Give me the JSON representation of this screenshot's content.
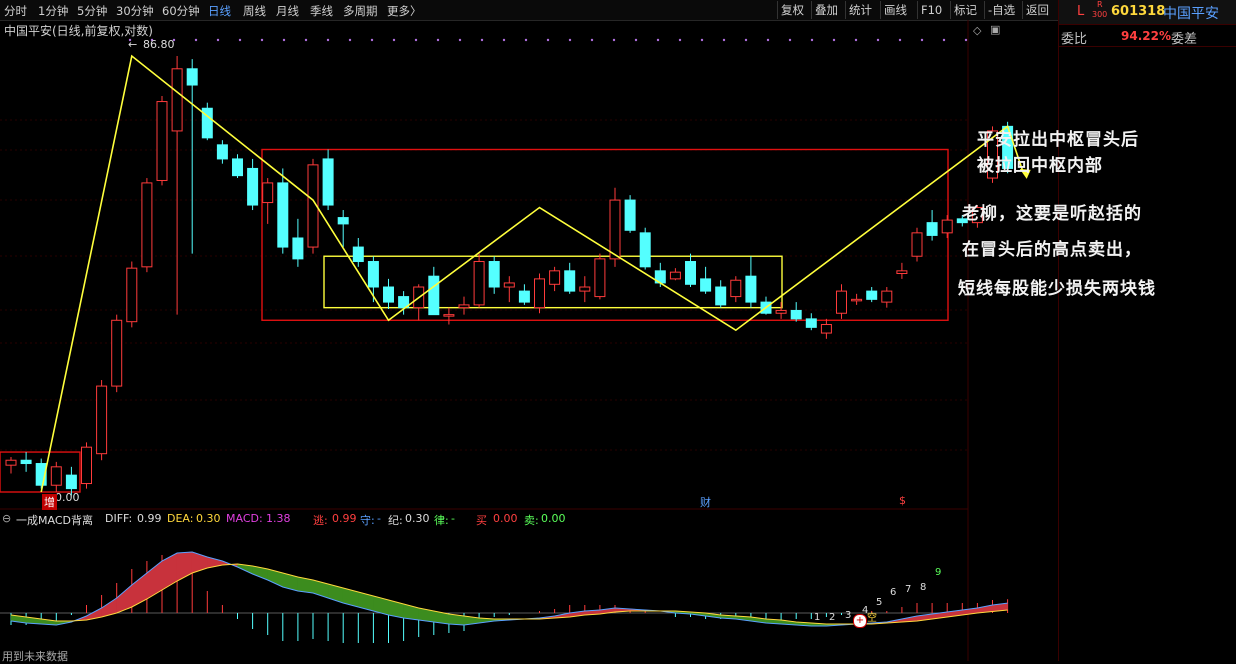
{
  "toolbar": {
    "timeframes": [
      "分时",
      "1分钟",
      "5分钟",
      "30分钟",
      "60分钟",
      "日线",
      "周线",
      "月线",
      "季线",
      "多周期",
      "更多〉"
    ],
    "active_timeframe": "日线",
    "buttons": [
      "复权",
      "叠加",
      "统计",
      "画线",
      "F10",
      "标记",
      "-自选",
      "返回"
    ]
  },
  "stock_header": {
    "letter": "L",
    "badge_top": "R",
    "badge_bottom": "300",
    "code": "601318",
    "name": "中国平安"
  },
  "ratio_row": {
    "label_left": "委比",
    "value": "94.22%",
    "label_right": "委差"
  },
  "chart_title": "中国平安(日线,前复权,对数)",
  "labels": {
    "peak_price": "86.80",
    "low_price": "0.00",
    "zeng_marker": "增",
    "cai_marker": "财",
    "s_marker": "$",
    "footer": "用到未来数据"
  },
  "annotations": {
    "line1": "平安拉出中枢冒头后",
    "line2": "被拉回中枢内部",
    "line3": "老柳，这要是听赵括的",
    "line4": "在冒头后的高点卖出，",
    "line5": "短线每股能少损失两块钱"
  },
  "indicator": {
    "name": "一成MACD背离",
    "diff_label": "DIFF:",
    "diff_value": "0.99",
    "dea_label": "DEA:",
    "dea_value": "0.30",
    "macd_label": "MACD:",
    "macd_value": "1.38",
    "tao_label": "逃:",
    "tao_value": "0.99",
    "shou_label": "守:",
    "shou_value": "-",
    "ji_label": "纪:",
    "ji_value": "0.30",
    "lv_label": "律:",
    "lv_value": "-",
    "mai_label": "买",
    "mai_value": "0.00",
    "mai2_label": "卖:",
    "mai2_value": "0.00",
    "count_labels": [
      "1",
      "2",
      "3",
      "4",
      "5",
      "6",
      "7",
      "8",
      "9"
    ],
    "kong_marker": "空"
  },
  "colors": {
    "up": "#ff3b3b",
    "down": "#54ffff",
    "zigzag": "#ffff3c",
    "box_red": "#e01010",
    "box_yellow": "#ffff3c",
    "macd_red": "#c8323c",
    "macd_green": "#3c8c1e",
    "accent_blue": "#5aa0ff",
    "accent_yellow": "#ffd83c"
  },
  "chart_data": [
    {
      "type": "candlestick",
      "title": "中国平安(日线,前复权,对数)",
      "price_max_label": 86.8,
      "candles": [
        {
          "o": 55.6,
          "h": 56.1,
          "l": 55.1,
          "c": 55.9
        },
        {
          "o": 55.9,
          "h": 56.4,
          "l": 55.2,
          "c": 55.7
        },
        {
          "o": 55.7,
          "h": 56.0,
          "l": 54.2,
          "c": 54.4
        },
        {
          "o": 54.4,
          "h": 55.8,
          "l": 54.0,
          "c": 55.5
        },
        {
          "o": 55.0,
          "h": 55.5,
          "l": 53.8,
          "c": 54.2
        },
        {
          "o": 54.5,
          "h": 57.0,
          "l": 54.2,
          "c": 56.7
        },
        {
          "o": 56.3,
          "h": 61.0,
          "l": 55.9,
          "c": 60.6
        },
        {
          "o": 60.6,
          "h": 65.5,
          "l": 60.2,
          "c": 65.1
        },
        {
          "o": 65.0,
          "h": 69.4,
          "l": 64.6,
          "c": 68.9
        },
        {
          "o": 69.0,
          "h": 76.0,
          "l": 68.6,
          "c": 75.6
        },
        {
          "o": 75.8,
          "h": 83.1,
          "l": 75.4,
          "c": 82.6
        },
        {
          "o": 80.0,
          "h": 86.8,
          "l": 65.5,
          "c": 85.6
        },
        {
          "o": 85.6,
          "h": 86.5,
          "l": 70.0,
          "c": 84.1
        },
        {
          "o": 82.0,
          "h": 82.5,
          "l": 79.2,
          "c": 79.4
        },
        {
          "o": 78.8,
          "h": 79.2,
          "l": 77.2,
          "c": 77.6
        },
        {
          "o": 77.6,
          "h": 78.0,
          "l": 76.0,
          "c": 76.2
        },
        {
          "o": 76.8,
          "h": 77.6,
          "l": 73.4,
          "c": 73.8
        },
        {
          "o": 74.0,
          "h": 76.0,
          "l": 72.3,
          "c": 75.6
        },
        {
          "o": 75.6,
          "h": 76.8,
          "l": 70.0,
          "c": 70.5
        },
        {
          "o": 71.2,
          "h": 72.7,
          "l": 69.0,
          "c": 69.6
        },
        {
          "o": 70.5,
          "h": 77.6,
          "l": 70.0,
          "c": 77.1
        },
        {
          "o": 77.6,
          "h": 78.4,
          "l": 73.4,
          "c": 73.8
        },
        {
          "o": 72.8,
          "h": 73.4,
          "l": 70.5,
          "c": 72.3
        },
        {
          "o": 70.5,
          "h": 71.2,
          "l": 69.0,
          "c": 69.4
        },
        {
          "o": 69.4,
          "h": 69.8,
          "l": 66.4,
          "c": 67.5
        },
        {
          "o": 67.5,
          "h": 68.1,
          "l": 65.9,
          "c": 66.4
        },
        {
          "o": 66.8,
          "h": 67.2,
          "l": 65.5,
          "c": 66.0
        },
        {
          "o": 66.0,
          "h": 67.7,
          "l": 65.1,
          "c": 67.5
        },
        {
          "o": 68.3,
          "h": 69.0,
          "l": 65.5,
          "c": 65.5
        },
        {
          "o": 65.5,
          "h": 66.0,
          "l": 64.8,
          "c": 65.5
        },
        {
          "o": 66.0,
          "h": 66.8,
          "l": 65.5,
          "c": 66.2
        },
        {
          "o": 66.2,
          "h": 70.0,
          "l": 66.0,
          "c": 69.4
        },
        {
          "o": 69.4,
          "h": 69.8,
          "l": 67.0,
          "c": 67.5
        },
        {
          "o": 67.5,
          "h": 68.3,
          "l": 66.4,
          "c": 67.8
        },
        {
          "o": 67.2,
          "h": 67.7,
          "l": 66.2,
          "c": 66.4
        },
        {
          "o": 66.0,
          "h": 68.5,
          "l": 65.6,
          "c": 68.1
        },
        {
          "o": 67.7,
          "h": 69.0,
          "l": 67.2,
          "c": 68.7
        },
        {
          "o": 68.7,
          "h": 69.3,
          "l": 67.0,
          "c": 67.2
        },
        {
          "o": 67.2,
          "h": 68.3,
          "l": 66.4,
          "c": 67.5
        },
        {
          "o": 66.8,
          "h": 70.0,
          "l": 66.6,
          "c": 69.6
        },
        {
          "o": 69.6,
          "h": 75.2,
          "l": 69.0,
          "c": 74.2
        },
        {
          "o": 74.2,
          "h": 74.6,
          "l": 71.6,
          "c": 71.8
        },
        {
          "o": 71.6,
          "h": 72.0,
          "l": 68.8,
          "c": 69.0
        },
        {
          "o": 68.7,
          "h": 69.3,
          "l": 67.5,
          "c": 67.8
        },
        {
          "o": 68.1,
          "h": 68.9,
          "l": 68.0,
          "c": 68.6
        },
        {
          "o": 69.4,
          "h": 70.0,
          "l": 67.5,
          "c": 67.7
        },
        {
          "o": 68.1,
          "h": 69.0,
          "l": 67.0,
          "c": 67.2
        },
        {
          "o": 67.5,
          "h": 68.0,
          "l": 66.0,
          "c": 66.2
        },
        {
          "o": 66.8,
          "h": 68.3,
          "l": 66.4,
          "c": 68.0
        },
        {
          "o": 68.3,
          "h": 69.8,
          "l": 66.0,
          "c": 66.4
        },
        {
          "o": 66.4,
          "h": 66.8,
          "l": 65.5,
          "c": 65.6
        },
        {
          "o": 65.6,
          "h": 66.4,
          "l": 65.2,
          "c": 65.8
        },
        {
          "o": 65.8,
          "h": 66.4,
          "l": 65.0,
          "c": 65.2
        },
        {
          "o": 65.2,
          "h": 65.6,
          "l": 64.4,
          "c": 64.6
        },
        {
          "o": 64.2,
          "h": 65.2,
          "l": 63.8,
          "c": 64.8
        },
        {
          "o": 65.6,
          "h": 67.7,
          "l": 65.2,
          "c": 67.2
        },
        {
          "o": 66.6,
          "h": 67.0,
          "l": 66.2,
          "c": 66.6
        },
        {
          "o": 67.2,
          "h": 67.5,
          "l": 66.4,
          "c": 66.6
        },
        {
          "o": 66.4,
          "h": 67.5,
          "l": 66.0,
          "c": 67.2
        },
        {
          "o": 68.5,
          "h": 69.3,
          "l": 68.1,
          "c": 68.7
        },
        {
          "o": 69.8,
          "h": 72.0,
          "l": 69.4,
          "c": 71.6
        },
        {
          "o": 72.4,
          "h": 73.4,
          "l": 71.0,
          "c": 71.4
        },
        {
          "o": 71.6,
          "h": 73.0,
          "l": 71.2,
          "c": 72.6
        },
        {
          "o": 72.7,
          "h": 73.0,
          "l": 72.1,
          "c": 72.4
        },
        {
          "o": 72.4,
          "h": 73.8,
          "l": 72.0,
          "c": 73.6
        },
        {
          "o": 76.0,
          "h": 80.4,
          "l": 75.6,
          "c": 80.0
        },
        {
          "o": 80.4,
          "h": 80.8,
          "l": 76.4,
          "c": 76.8
        }
      ],
      "zigzag_points": [
        {
          "i": 2,
          "price": 54.0
        },
        {
          "i": 8,
          "price": 86.8
        },
        {
          "i": 20,
          "price": 74.2
        },
        {
          "i": 25,
          "price": 65.1
        },
        {
          "i": 35,
          "price": 73.6
        },
        {
          "i": 48,
          "price": 64.4
        },
        {
          "i": 66,
          "price": 80.4
        },
        {
          "i": 67,
          "price": 76.6
        }
      ]
    },
    {
      "type": "area",
      "title": "一成MACD背离",
      "series": [
        {
          "name": "DIFF",
          "values": [
            -0.8,
            -1.0,
            -1.1,
            -1.2,
            -0.9,
            -0.3,
            0.5,
            1.5,
            2.8,
            4.0,
            5.2,
            6.0,
            6.1,
            5.6,
            5.2,
            4.6,
            3.9,
            3.3,
            2.6,
            2.2,
            2.0,
            1.5,
            1.0,
            0.6,
            0.2,
            -0.2,
            -0.5,
            -0.7,
            -0.9,
            -1.1,
            -1.2,
            -1.0,
            -0.8,
            -0.7,
            -0.6,
            -0.5,
            -0.3,
            0.0,
            0.2,
            0.3,
            0.5,
            0.4,
            0.3,
            0.2,
            0.0,
            -0.1,
            -0.3,
            -0.5,
            -0.6,
            -0.8,
            -1.0,
            -1.1,
            -1.2,
            -1.3,
            -1.3,
            -1.2,
            -1.1,
            -1.0,
            -0.9,
            -0.6,
            -0.3,
            -0.1,
            0.1,
            0.3,
            0.5,
            0.8,
            0.99
          ]
        },
        {
          "name": "DEA",
          "values": [
            -0.2,
            -0.4,
            -0.6,
            -0.8,
            -0.8,
            -0.7,
            -0.4,
            0.0,
            0.6,
            1.4,
            2.3,
            3.2,
            4.0,
            4.5,
            4.8,
            4.9,
            4.7,
            4.4,
            4.0,
            3.6,
            3.3,
            2.9,
            2.5,
            2.1,
            1.7,
            1.3,
            0.9,
            0.5,
            0.2,
            -0.1,
            -0.3,
            -0.5,
            -0.6,
            -0.6,
            -0.6,
            -0.6,
            -0.5,
            -0.4,
            -0.2,
            -0.1,
            0.1,
            0.2,
            0.2,
            0.2,
            0.2,
            0.1,
            0.0,
            -0.2,
            -0.3,
            -0.4,
            -0.6,
            -0.7,
            -0.9,
            -1.0,
            -1.1,
            -1.1,
            -1.1,
            -1.1,
            -1.0,
            -0.9,
            -0.8,
            -0.6,
            -0.4,
            -0.2,
            0.0,
            0.15,
            0.3
          ]
        },
        {
          "name": "MACD",
          "values": [
            -1.2,
            -1.2,
            -1.0,
            -0.8,
            -0.2,
            0.8,
            1.8,
            3.0,
            4.4,
            5.2,
            5.8,
            5.6,
            4.2,
            2.2,
            0.8,
            -0.6,
            -1.6,
            -2.2,
            -2.8,
            -2.8,
            -2.6,
            -2.8,
            -3.0,
            -3.0,
            -3.0,
            -3.0,
            -2.8,
            -2.4,
            -2.2,
            -2.0,
            -1.8,
            -1.0,
            -0.4,
            -0.2,
            0.0,
            0.2,
            0.4,
            0.8,
            0.8,
            0.8,
            0.8,
            0.4,
            0.2,
            0.0,
            -0.4,
            -0.4,
            -0.6,
            -0.6,
            -0.6,
            -0.8,
            -0.8,
            -0.8,
            -0.6,
            -0.6,
            -0.4,
            -0.2,
            0.0,
            0.2,
            0.2,
            0.6,
            1.0,
            1.0,
            1.0,
            1.0,
            1.0,
            1.3,
            1.38
          ]
        }
      ]
    }
  ]
}
